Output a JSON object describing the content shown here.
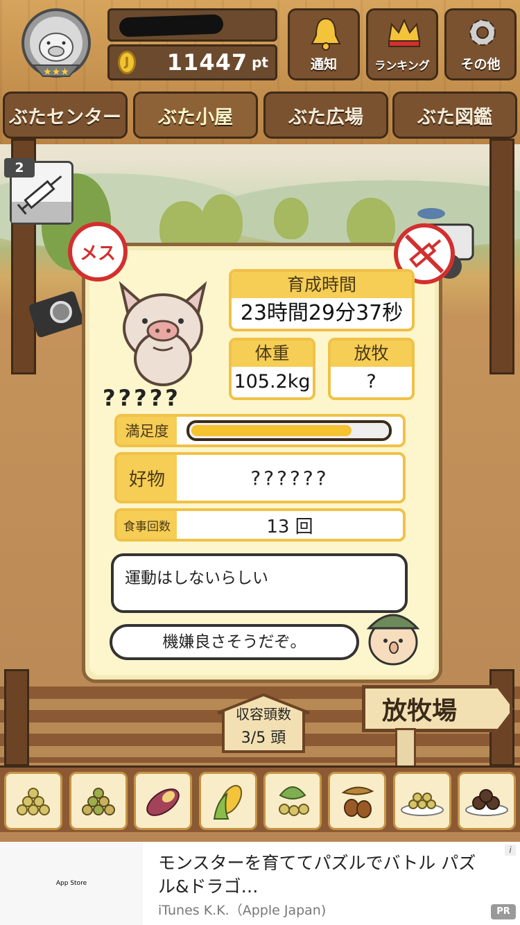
{
  "header": {
    "points_value": "11447",
    "points_unit": "pt",
    "coin_symbol": "J",
    "buttons": [
      {
        "label": "通知",
        "icon": "bell-icon"
      },
      {
        "label": "ランキング",
        "icon": "crown-icon"
      },
      {
        "label": "その他",
        "icon": "gear-icon"
      }
    ]
  },
  "nav": {
    "tabs": [
      {
        "label": "ぶたセンター"
      },
      {
        "label": "ぶた小屋",
        "active": true
      },
      {
        "label": "ぶた広場"
      },
      {
        "label": "ぶた図鑑"
      }
    ]
  },
  "item": {
    "count": "2",
    "icon": "syringe-icon"
  },
  "pig": {
    "gender_label": "メス",
    "name": "?????",
    "raising_time_label": "育成時間",
    "raising_time": "23時間29分37秒",
    "weight_label": "体重",
    "weight": "105.2kg",
    "grazing_label": "放牧",
    "grazing": "?",
    "satisfaction_label": "満足度",
    "satisfaction": 0.82,
    "favorite_label": "好物",
    "favorite": "??????",
    "meals_label": "食事回数",
    "meals": "13 回",
    "speech1": "運動はしないらしい",
    "speech2": "機嫌良さそうだぞ。"
  },
  "bottom": {
    "capacity_label": "収容頭数",
    "capacity_value": "3/5 頭",
    "pasture_button": "放牧場",
    "foods": [
      "soybeans-icon",
      "mixed-beans-icon",
      "sweet-potato-icon",
      "corn-icon",
      "leafy-beans-icon",
      "acorn-icon",
      "grain-plate-icon",
      "meatball-plate-icon"
    ]
  },
  "ad": {
    "thumb_text": "App Store",
    "title": "モンスターを育ててパズルでバトル パズル&ドラゴ…",
    "sub": "iTunes K.K.（Apple Japan)",
    "info": "i",
    "pr": "PR"
  },
  "colors": {
    "accent": "#f6cd55",
    "wood": "#7a5230",
    "alert": "#d32f2f"
  }
}
